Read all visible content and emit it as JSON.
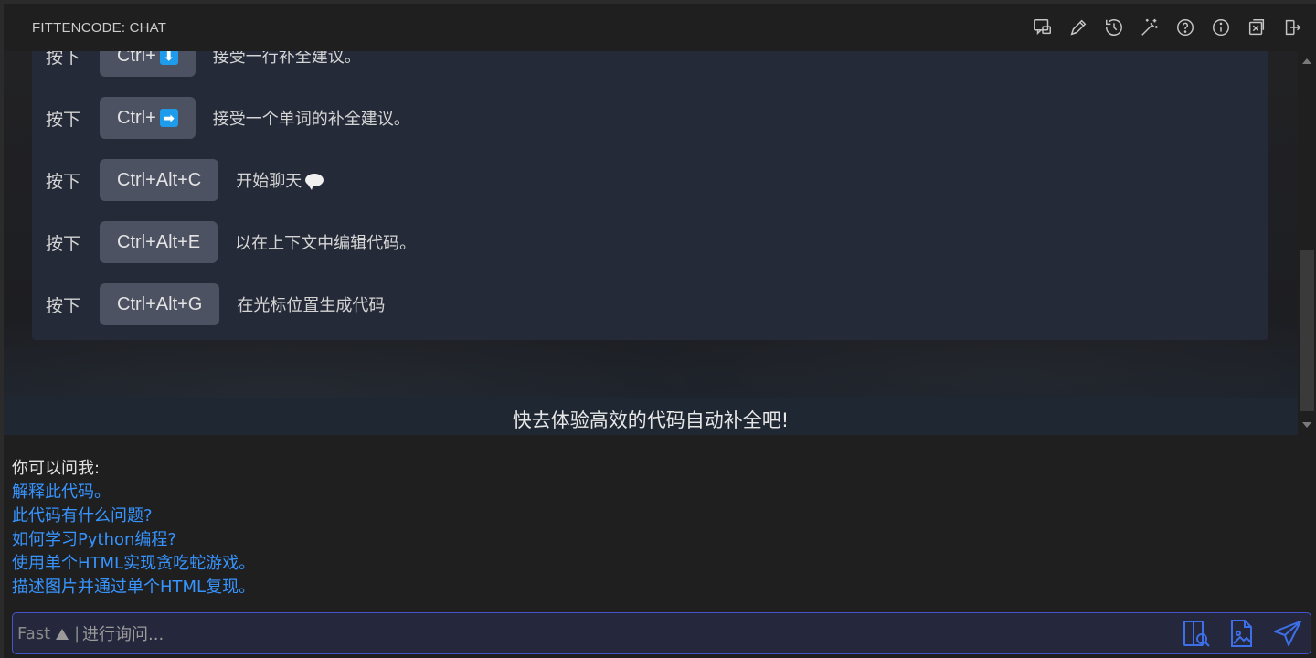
{
  "header": {
    "title": "FITTENCODE: CHAT",
    "icons": [
      "chat-new-icon",
      "pencil-icon",
      "history-icon",
      "magic-wand-icon",
      "help-icon",
      "info-icon",
      "close-panel-icon",
      "logout-icon"
    ]
  },
  "shortcuts": [
    {
      "press": "按下",
      "key": "Ctrl+",
      "badge": "⬇",
      "desc": "接受一行补全建议。"
    },
    {
      "press": "按下",
      "key": "Ctrl+",
      "badge": "➡",
      "desc": "接受一个单词的补全建议。"
    },
    {
      "press": "按下",
      "key": "Ctrl+Alt+C",
      "desc": "开始聊天"
    },
    {
      "press": "按下",
      "key": "Ctrl+Alt+E",
      "desc": "以在上下文中编辑代码。"
    },
    {
      "press": "按下",
      "key": "Ctrl+Alt+G",
      "desc": "在光标位置生成代码"
    }
  ],
  "slogan": "快去体验高效的代码自动补全吧!",
  "suggestions": {
    "title": "你可以问我:",
    "items": [
      "解释此代码。",
      "此代码有什么问题?",
      "如何学习Python编程?",
      "使用单个HTML实现贪吃蛇游戏。",
      "描述图片并通过单个HTML复现。"
    ]
  },
  "input": {
    "mode": "Fast",
    "separator": "|",
    "placeholder": "进行询问..."
  },
  "colors": {
    "accent": "#3794ff",
    "input_border": "#4455cc",
    "key_bg": "#4d5263",
    "panel_bg": "#252a38"
  }
}
